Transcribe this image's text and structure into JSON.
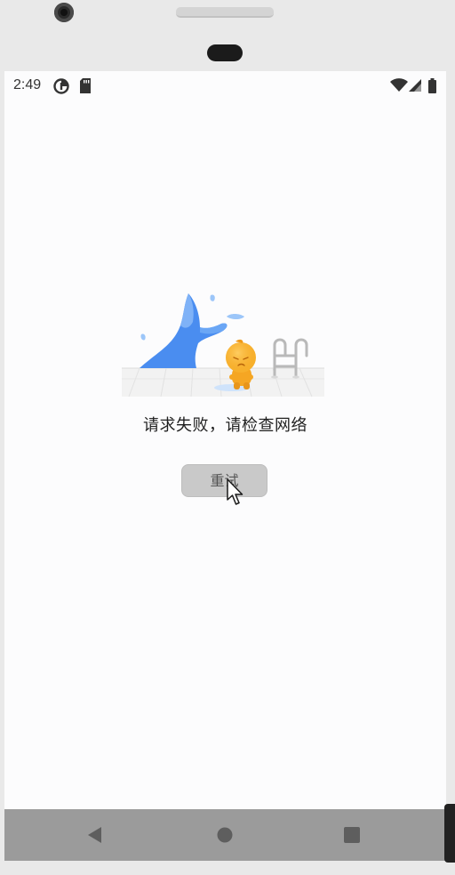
{
  "status_bar": {
    "time": "2:49",
    "left_icons": [
      "data-saver-icon",
      "sd-card-icon"
    ],
    "right_icons": [
      "wifi-icon",
      "signal-icon",
      "battery-icon"
    ]
  },
  "error": {
    "message": "请求失败，请检查网络"
  },
  "retry_button": {
    "label": "重试"
  },
  "nav_bar": {
    "buttons": [
      "back-icon",
      "home-icon",
      "recents-icon"
    ]
  },
  "colors": {
    "screen_bg": "#fcfcfd",
    "button_bg": "#c9c9c9",
    "nav_bg": "#9b9b9b",
    "illustration_blue": "#4a8df0",
    "illustration_orange": "#f5a623"
  }
}
